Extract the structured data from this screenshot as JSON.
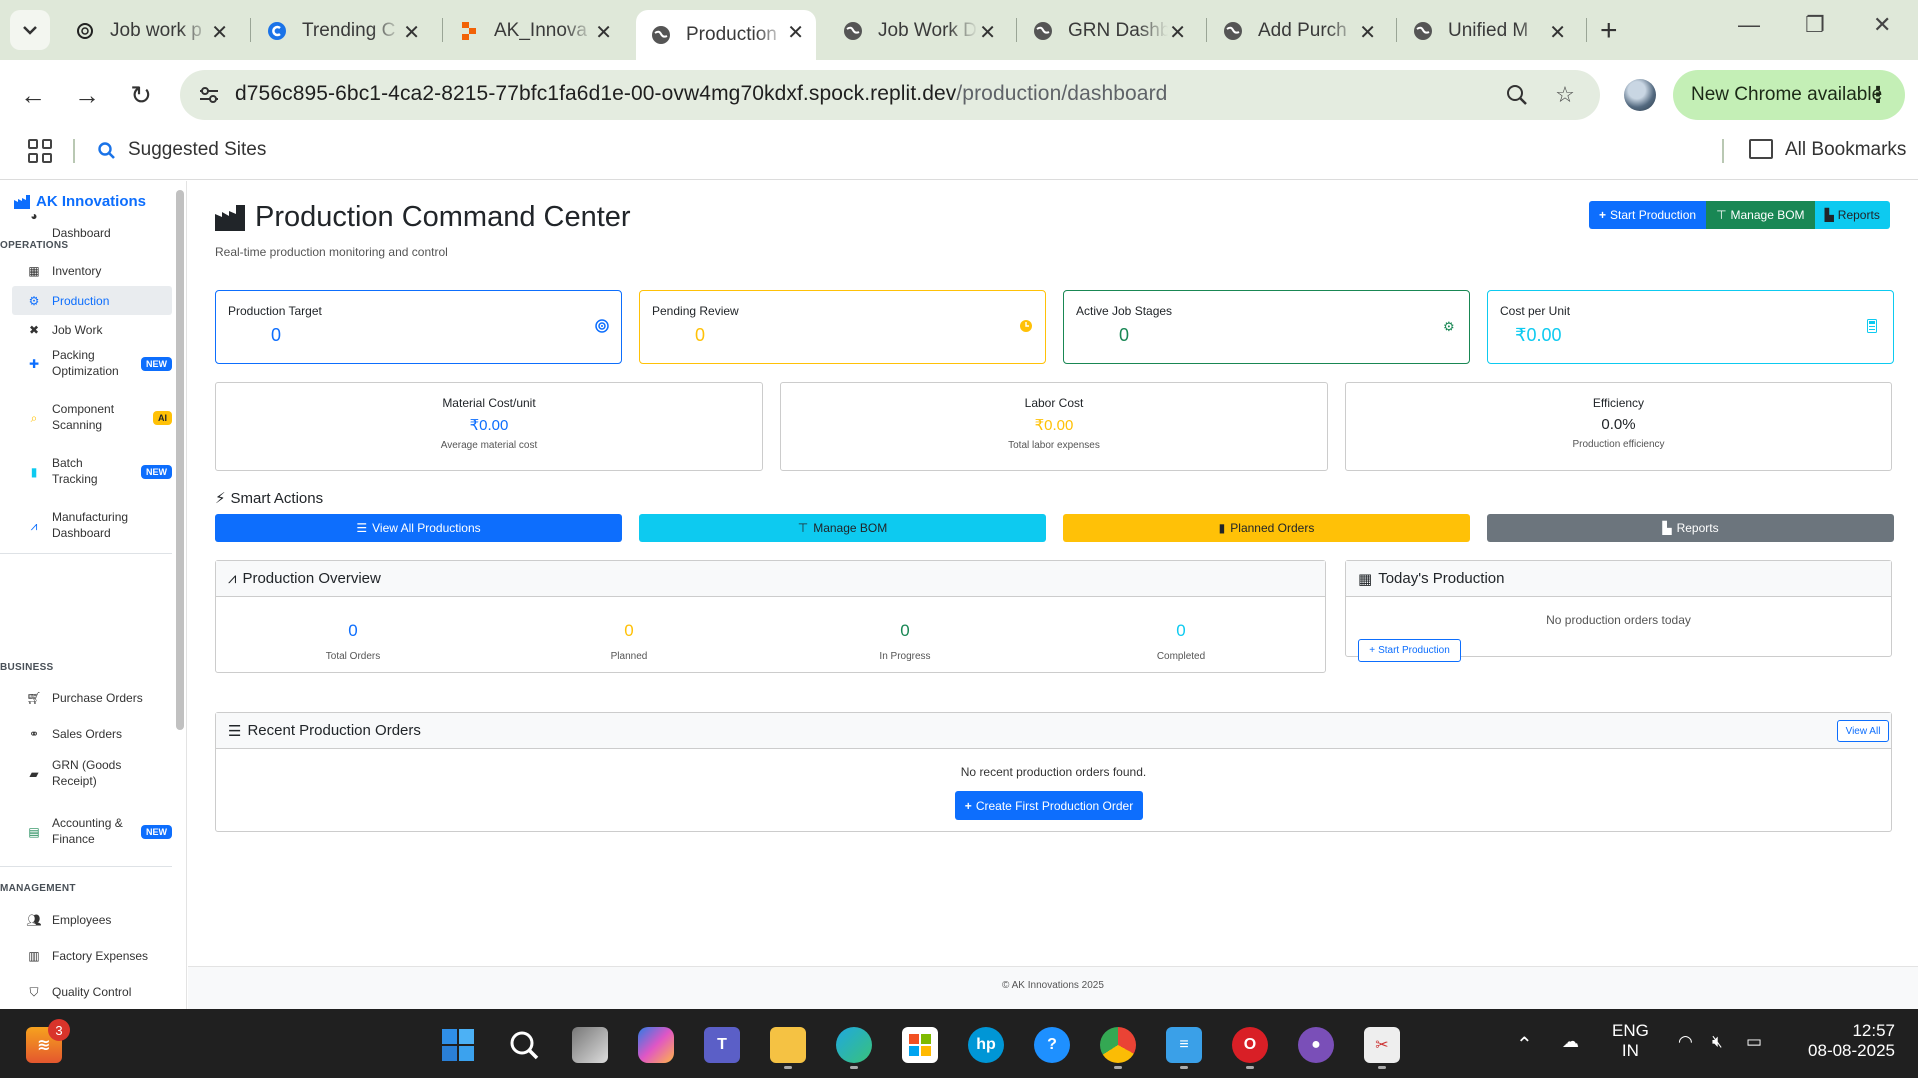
{
  "browser": {
    "tabs": [
      {
        "title": "Job work p",
        "icon": "openai-icon"
      },
      {
        "title": "Trending C",
        "icon": "c-logo-icon"
      },
      {
        "title": "AK_Innova",
        "icon": "replit-icon"
      },
      {
        "title": "Production",
        "icon": "globe-icon"
      },
      {
        "title": "Job Work D",
        "icon": "globe-icon"
      },
      {
        "title": "GRN Dashb",
        "icon": "globe-icon"
      },
      {
        "title": "Add Purch",
        "icon": "globe-icon"
      },
      {
        "title": "Unified M",
        "icon": "globe-icon"
      }
    ],
    "url_host": "d756c895-6bc1-4ca2-8215-77bfc1fa6d1e-00-ovw4mg70kdxf.spock.replit.dev",
    "url_path": "/production/dashboard",
    "new_chrome": "New Chrome available",
    "bookmarks": {
      "suggested": "Suggested Sites",
      "all": "All Bookmarks"
    }
  },
  "sidebar": {
    "brand": "AK Innovations",
    "dashboard": "Dashboard",
    "sections": {
      "operations": "OPERATIONS",
      "business": "BUSINESS",
      "management": "MANAGEMENT"
    },
    "operations": [
      {
        "label": "Inventory",
        "icon": "boxes-icon"
      },
      {
        "label": "Production",
        "icon": "cogs-icon"
      },
      {
        "label": "Job Work",
        "icon": "tools-icon"
      },
      {
        "label": "Packing Optimization",
        "icon": "puzzle-icon",
        "badge": "NEW"
      },
      {
        "label": "Component Scanning",
        "icon": "search-icon",
        "badge": "AI"
      },
      {
        "label": "Batch Tracking",
        "icon": "barcode-icon",
        "badge": "NEW"
      },
      {
        "label": "Manufacturing Dashboard",
        "icon": "chart-line-icon"
      }
    ],
    "business": [
      {
        "label": "Purchase Orders",
        "icon": "cart-icon"
      },
      {
        "label": "Sales Orders",
        "icon": "handshake-icon"
      },
      {
        "label": "GRN (Goods Receipt)",
        "icon": "truck-icon"
      },
      {
        "label": "Accounting & Finance",
        "icon": "calculator-icon",
        "badge": "NEW"
      }
    ],
    "management": [
      {
        "label": "Employees",
        "icon": "users-icon"
      },
      {
        "label": "Factory Expenses",
        "icon": "receipt-icon"
      },
      {
        "label": "Quality Control",
        "icon": "shield-icon"
      }
    ]
  },
  "page": {
    "title": "Production Command Center",
    "subtitle": "Real-time production monitoring and control",
    "header_buttons": {
      "start": "Start Production",
      "bom": "Manage BOM",
      "reports": "Reports"
    }
  },
  "stats": [
    {
      "label": "Production Target",
      "value": "0",
      "color": "#0d6efd",
      "icon": "target-icon"
    },
    {
      "label": "Pending Review",
      "value": "0",
      "color": "#ffc107",
      "icon": "clock-icon"
    },
    {
      "label": "Active Job Stages",
      "value": "0",
      "color": "#198754",
      "icon": "cogs-icon"
    },
    {
      "label": "Cost per Unit",
      "value": "₹0.00",
      "color": "#0dcaf0",
      "icon": "calculator-icon"
    }
  ],
  "cost_cards": [
    {
      "title": "Material Cost/unit",
      "value": "₹0.00",
      "sub": "Average material cost",
      "color": "#0d6efd"
    },
    {
      "title": "Labor Cost",
      "value": "₹0.00",
      "sub": "Total labor expenses",
      "color": "#ffc107"
    },
    {
      "title": "Efficiency",
      "value": "0.0%",
      "sub": "Production efficiency",
      "color": "#212529"
    }
  ],
  "smart_actions": {
    "title": "Smart Actions",
    "buttons": [
      {
        "label": "View All Productions",
        "bg": "#0d6efd",
        "fg": "#ffffff",
        "icon": "list-icon"
      },
      {
        "label": "Manage BOM",
        "bg": "#0dcaf0",
        "fg": "#212529",
        "icon": "sitemap-icon"
      },
      {
        "label": "Planned Orders",
        "bg": "#ffc107",
        "fg": "#212529",
        "icon": "clipboard-icon"
      },
      {
        "label": "Reports",
        "bg": "#6c757d",
        "fg": "#ffffff",
        "icon": "chart-bar-icon"
      }
    ]
  },
  "overview": {
    "title": "Production Overview",
    "items": [
      {
        "value": "0",
        "label": "Total Orders",
        "color": "#0d6efd"
      },
      {
        "value": "0",
        "label": "Planned",
        "color": "#ffc107"
      },
      {
        "value": "0",
        "label": "In Progress",
        "color": "#198754"
      },
      {
        "value": "0",
        "label": "Completed",
        "color": "#0dcaf0"
      }
    ]
  },
  "today": {
    "title": "Today's Production",
    "empty": "No production orders today",
    "button": "Start Production"
  },
  "recent": {
    "title": "Recent Production Orders",
    "view_all": "View All",
    "empty": "No recent production orders found.",
    "create": "Create First Production Order"
  },
  "footer": "© AK Innovations 2025",
  "taskbar": {
    "lang1": "ENG",
    "lang2": "IN",
    "time": "12:57",
    "date": "08-08-2025",
    "notif_count": "3"
  }
}
